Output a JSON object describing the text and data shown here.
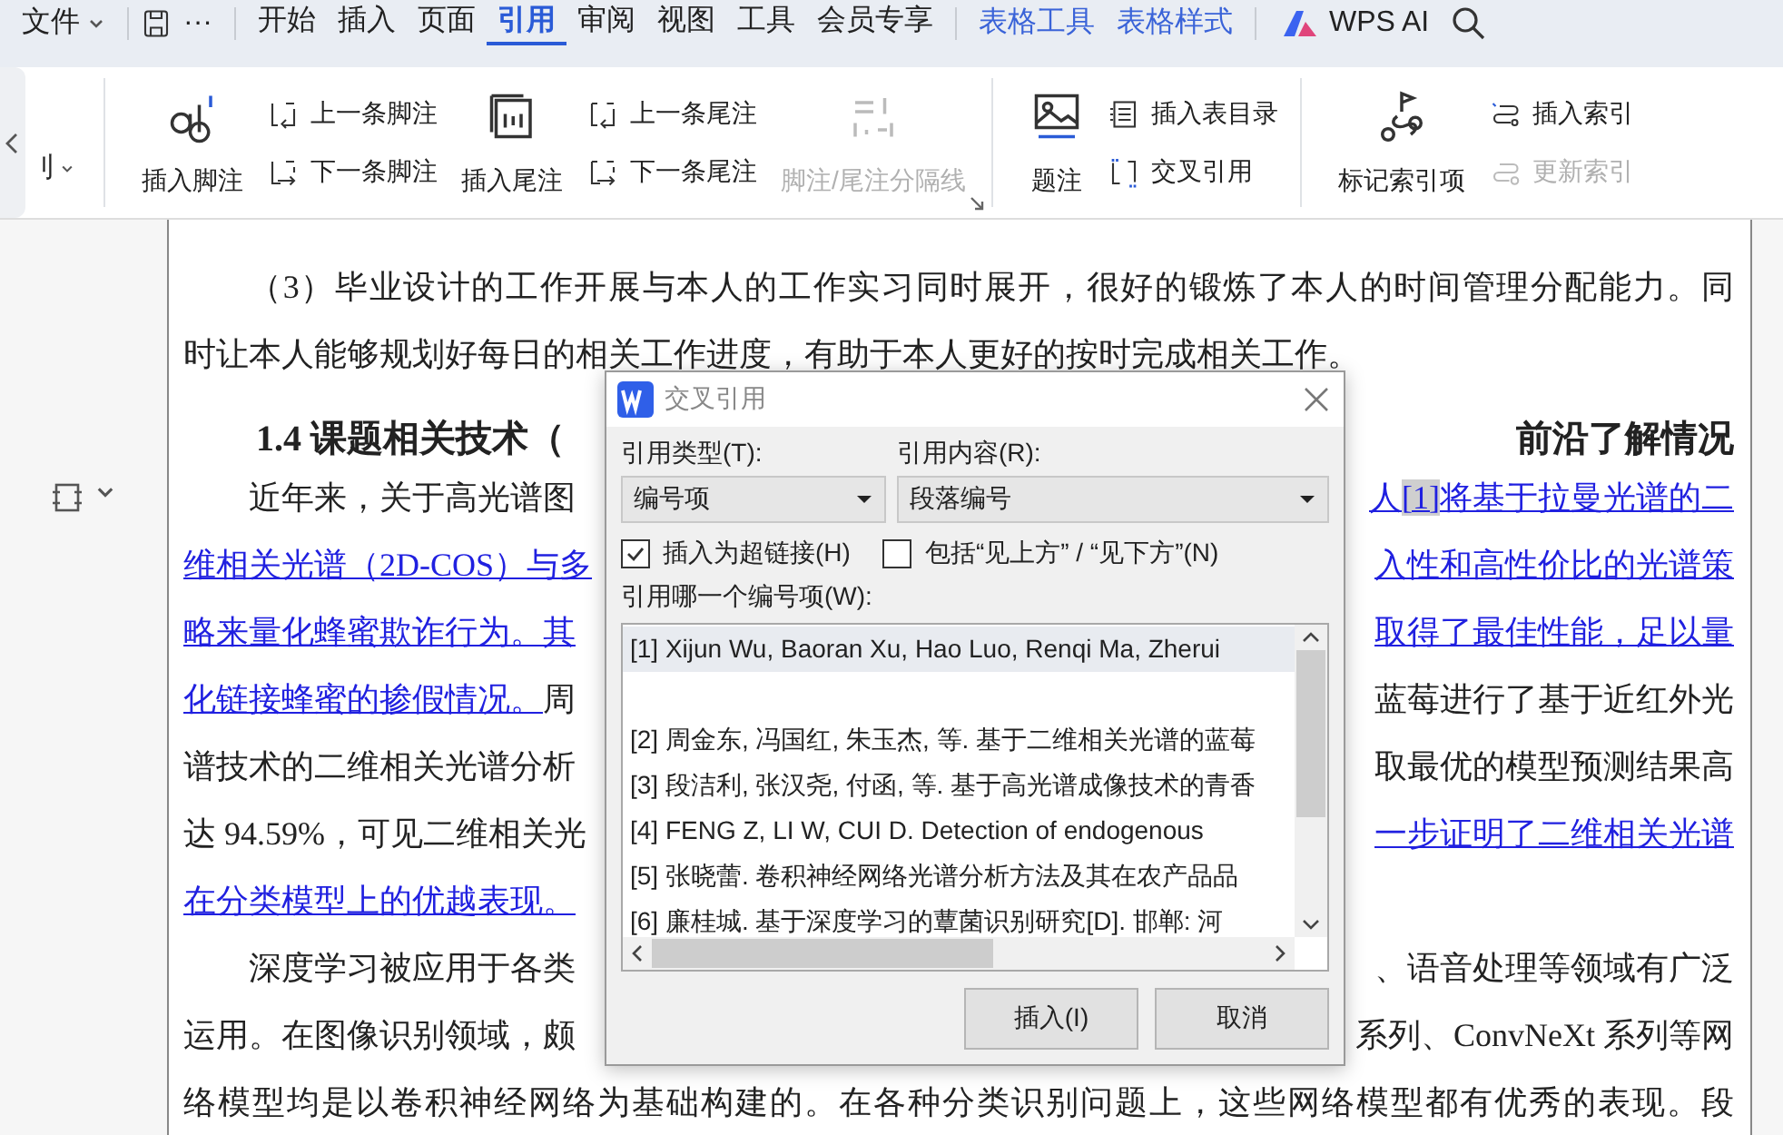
{
  "menubar": {
    "file": "文件",
    "more": "···",
    "tabs": [
      {
        "label": "开始",
        "selected": false
      },
      {
        "label": "插入",
        "selected": false
      },
      {
        "label": "页面",
        "selected": false
      },
      {
        "label": "引用",
        "selected": true
      },
      {
        "label": "审阅",
        "selected": false
      },
      {
        "label": "视图",
        "selected": false
      },
      {
        "label": "工具",
        "selected": false
      },
      {
        "label": "会员专享",
        "selected": false
      }
    ],
    "context_tabs": [
      "表格工具",
      "表格样式"
    ],
    "ai": "WPS AI"
  },
  "ribbon": {
    "cut_label": "刂",
    "groups": [
      {
        "launcher": true,
        "items": [
          {
            "kind": "big",
            "label": "插入脚注",
            "disabled": false
          },
          {
            "kind": "stack",
            "buttons": [
              {
                "label": "上一条脚注",
                "disabled": false
              },
              {
                "label": "下一条脚注",
                "disabled": false
              }
            ]
          },
          {
            "kind": "big",
            "label": "插入尾注",
            "disabled": false
          },
          {
            "kind": "stack",
            "buttons": [
              {
                "label": "上一条尾注",
                "disabled": false
              },
              {
                "label": "下一条尾注",
                "disabled": false
              }
            ]
          },
          {
            "kind": "big",
            "label": "脚注/尾注分隔线",
            "disabled": true
          }
        ]
      },
      {
        "launcher": false,
        "items": [
          {
            "kind": "big",
            "label": "题注",
            "disabled": false
          },
          {
            "kind": "stack",
            "buttons": [
              {
                "label": "插入表目录",
                "disabled": false
              },
              {
                "label": "交叉引用",
                "disabled": false
              }
            ]
          }
        ]
      },
      {
        "launcher": false,
        "items": [
          {
            "kind": "big",
            "label": "标记索引项",
            "disabled": false
          },
          {
            "kind": "stack",
            "buttons": [
              {
                "label": "插入索引",
                "disabled": false
              },
              {
                "label": "更新索引",
                "disabled": true
              }
            ]
          }
        ]
      }
    ]
  },
  "document": {
    "lines": [
      {
        "kind": "full",
        "indent": true,
        "left": [
          {
            "kind": "plain",
            "text": "（3）毕业设计的工作开展与本人的工作实习同时展开，很好的锻炼了本人的时间管理分配能力。同"
          }
        ]
      },
      {
        "kind": "end",
        "indent": false,
        "left": [
          {
            "kind": "plain",
            "text": "时让本人能够规划好每日的相关工作进度，有助于本人更好的按时完成相关工作。"
          }
        ]
      },
      {
        "kind": "heading",
        "indent": true,
        "left": [
          {
            "kind": "plain",
            "text": "1.4  课题相关技术（"
          }
        ],
        "right": [
          {
            "kind": "plain",
            "text": "前沿了解情况"
          }
        ]
      },
      {
        "kind": "split",
        "indent": true,
        "left": [
          {
            "kind": "plain",
            "text": "近年来，关于高光谱图"
          }
        ],
        "right": [
          {
            "kind": "link",
            "text": "人"
          },
          {
            "kind": "field",
            "text": "[1]"
          },
          {
            "kind": "link",
            "text": "将基于拉曼光谱的二"
          }
        ]
      },
      {
        "kind": "split",
        "indent": false,
        "left": [
          {
            "kind": "link",
            "text": "维相关光谱（2D-COS）与多"
          }
        ],
        "right": [
          {
            "kind": "link",
            "text": "入性和高性价比的光谱策"
          }
        ]
      },
      {
        "kind": "split",
        "indent": false,
        "left": [
          {
            "kind": "link",
            "text": "略来量化蜂蜜欺诈行为。其"
          }
        ],
        "right": [
          {
            "kind": "link",
            "text": "取得了最佳性能，足以量"
          }
        ]
      },
      {
        "kind": "split",
        "indent": false,
        "left": [
          {
            "kind": "link",
            "text": "化链接蜂蜜的掺假情况。"
          },
          {
            "kind": "plain",
            "text": "周"
          }
        ],
        "right": [
          {
            "kind": "plain",
            "text": "蓝莓进行了基于近红外光"
          }
        ]
      },
      {
        "kind": "split",
        "indent": false,
        "left": [
          {
            "kind": "plain",
            "text": "谱技术的二维相关光谱分析"
          }
        ],
        "right": [
          {
            "kind": "plain",
            "text": "取最优的模型预测结果高"
          }
        ]
      },
      {
        "kind": "split",
        "indent": false,
        "left": [
          {
            "kind": "plain",
            "text": "达 94.59%，可见二维相关光"
          }
        ],
        "right": [
          {
            "kind": "link",
            "text": "一步证明了二维相关光谱"
          }
        ]
      },
      {
        "kind": "split",
        "indent": false,
        "left": [
          {
            "kind": "link",
            "text": "在分类模型上的优越表现。"
          }
        ]
      },
      {
        "kind": "split",
        "indent": true,
        "left": [
          {
            "kind": "plain",
            "text": "深度学习被应用于各类"
          }
        ],
        "right": [
          {
            "kind": "plain",
            "text": "、语音处理等领域有广泛"
          }
        ]
      },
      {
        "kind": "split",
        "indent": false,
        "left": [
          {
            "kind": "plain",
            "text": "运用。在图像识别领域，颇"
          }
        ],
        "right": [
          {
            "kind": "plain",
            "text": "系列、ConvNeXt 系列等网"
          }
        ]
      },
      {
        "kind": "full",
        "indent": false,
        "left": [
          {
            "kind": "plain",
            "text": "络模型均是以卷积神经网络为基础构建的。在各种分类识别问题上，这些网络模型都有优秀的表现。段"
          }
        ]
      }
    ]
  },
  "dialog": {
    "title": "交叉引用",
    "type_label": "引用类型(T):",
    "type_value": "编号项",
    "content_label": "引用内容(R):",
    "content_value": "段落编号",
    "options": [
      {
        "label": "插入为超链接(H)",
        "checked": true
      },
      {
        "label": "包括“见上方” / “见下方”(N)",
        "checked": false
      }
    ],
    "list_label": "引用哪一个编号项(W):",
    "items": [
      {
        "kind": "entry",
        "text": "[1] Xijun Wu, Baoran Xu, Hao Luo, Renqi Ma, Zherui",
        "selected": true
      },
      {
        "kind": "blank",
        "selected": false
      },
      {
        "kind": "entry",
        "text": "[2] 周金东, 冯国红, 朱玉杰, 等. 基于二维相关光谱的蓝莓",
        "selected": false
      },
      {
        "kind": "entry",
        "text": "[3] 段洁利, 张汉尧, 付函, 等. 基于高光谱成像技术的青香",
        "selected": false
      },
      {
        "kind": "entry",
        "text": "[4] FENG Z, LI W, CUI D. Detection of endogenous",
        "selected": false
      },
      {
        "kind": "entry",
        "text": "[5] 张晓蕾. 卷积神经网络光谱分析方法及其在农产品品",
        "selected": false
      },
      {
        "kind": "entry",
        "text": "[6] 廉桂城. 基于深度学习的蕈菌识别研究[D]. 邯郸: 河",
        "selected": false
      }
    ],
    "buttons": [
      "插入(I)",
      "取消"
    ]
  }
}
